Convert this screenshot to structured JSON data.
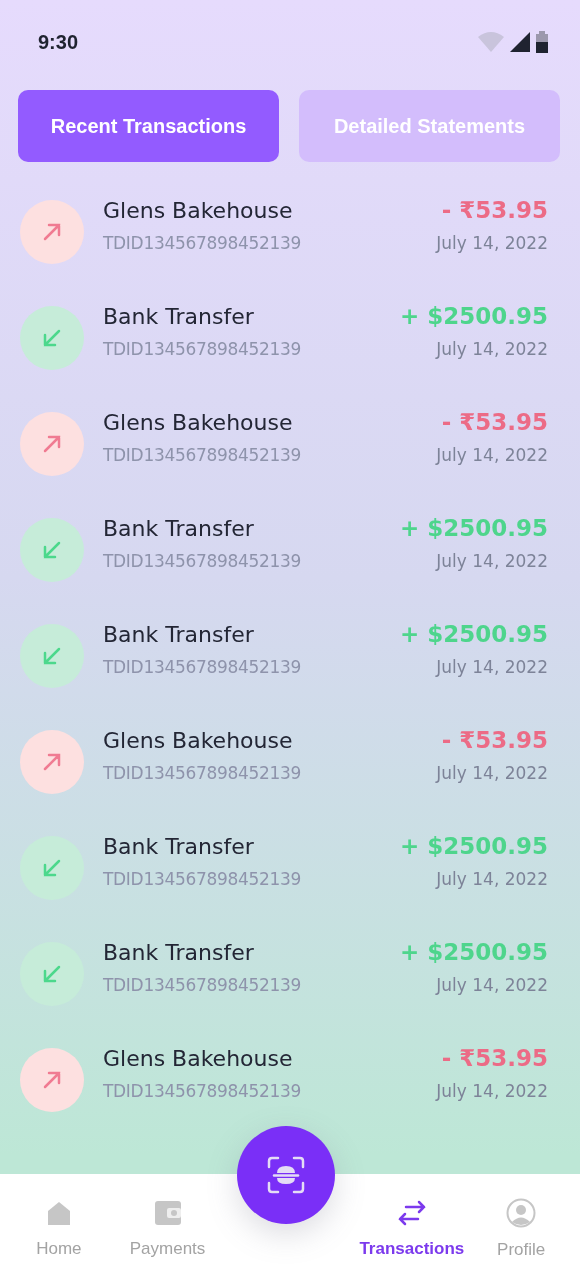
{
  "status_bar": {
    "time": "9:30"
  },
  "tabs": [
    {
      "label": "Recent Transactions",
      "selected": true
    },
    {
      "label": "Detailed Statements",
      "selected": false
    }
  ],
  "transactions": [
    {
      "kind": "debit",
      "name": "Glens Bakehouse",
      "id": "TDID134567898452139",
      "amount": "- ₹53.95",
      "date": "July 14, 2022"
    },
    {
      "kind": "credit",
      "name": "Bank Transfer",
      "id": "TDID134567898452139",
      "amount": "+ $2500.95",
      "date": "July 14, 2022"
    },
    {
      "kind": "debit",
      "name": "Glens Bakehouse",
      "id": "TDID134567898452139",
      "amount": "- ₹53.95",
      "date": "July 14, 2022"
    },
    {
      "kind": "credit",
      "name": "Bank Transfer",
      "id": "TDID134567898452139",
      "amount": "+ $2500.95",
      "date": "July 14, 2022"
    },
    {
      "kind": "credit",
      "name": "Bank Transfer",
      "id": "TDID134567898452139",
      "amount": "+ $2500.95",
      "date": "July 14, 2022"
    },
    {
      "kind": "debit",
      "name": "Glens Bakehouse",
      "id": "TDID134567898452139",
      "amount": "- ₹53.95",
      "date": "July 14, 2022"
    },
    {
      "kind": "credit",
      "name": "Bank Transfer",
      "id": "TDID134567898452139",
      "amount": "+ $2500.95",
      "date": "July 14, 2022"
    },
    {
      "kind": "credit",
      "name": "Bank Transfer",
      "id": "TDID134567898452139",
      "amount": "+ $2500.95",
      "date": "July 14, 2022"
    },
    {
      "kind": "debit",
      "name": "Glens Bakehouse",
      "id": "TDID134567898452139",
      "amount": "- ₹53.95",
      "date": "July 14, 2022"
    }
  ],
  "nav": [
    {
      "kind": "home",
      "label": "Home",
      "selected": false
    },
    {
      "kind": "payments",
      "label": "Payments",
      "selected": false
    },
    {
      "kind": "transactions",
      "label": "Transactions",
      "selected": true
    },
    {
      "kind": "profile",
      "label": "Profile",
      "selected": false
    }
  ]
}
